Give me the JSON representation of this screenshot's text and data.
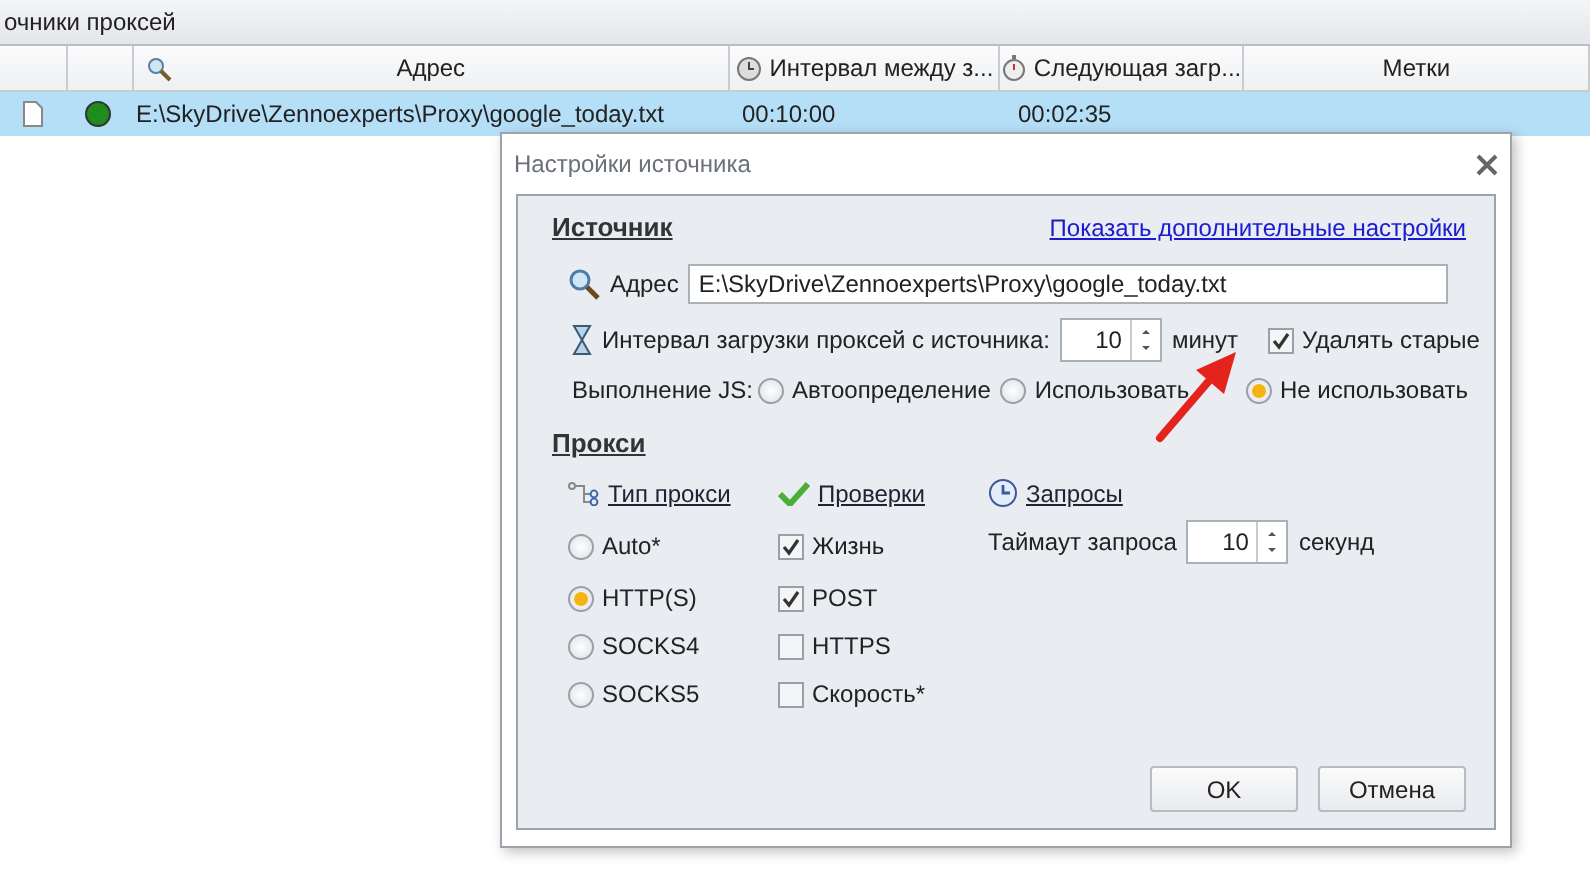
{
  "panel_title": "очники проксей",
  "table": {
    "columns": [
      "",
      "",
      "Адрес",
      "Интервал между з...",
      "Следующая загр...",
      "Метки"
    ],
    "rows": [
      {
        "selected": true,
        "active": true,
        "address": "E:\\SkyDrive\\Zennoexperts\\Proxy\\google_today.txt",
        "interval": "00:10:00",
        "next": "00:02:35"
      }
    ]
  },
  "dialog": {
    "title": "Настройки источника",
    "source": {
      "heading": "Источник",
      "more_link": "Показать дополнительные настройки",
      "address_label": "Адрес",
      "address_value": "E:\\SkyDrive\\Zennoexperts\\Proxy\\google_today.txt",
      "interval_label": "Интервал загрузки проксей с источника:",
      "interval_value": "10",
      "interval_unit": "минут",
      "delete_old": {
        "label": "Удалять старые",
        "checked": true
      },
      "js_label": "Выполнение JS:",
      "js_options": [
        {
          "label": "Автоопределение",
          "selected": false
        },
        {
          "label": "Использовать",
          "selected": false
        },
        {
          "label": "Не использовать",
          "selected": true
        }
      ]
    },
    "proxy": {
      "heading": "Прокси",
      "type_link": "Тип прокси",
      "checks_link": "Проверки",
      "requests_link": "Запросы",
      "types": [
        {
          "label": "Auto*",
          "selected": false
        },
        {
          "label": "HTTP(S)",
          "selected": true
        },
        {
          "label": "SOCKS4",
          "selected": false
        },
        {
          "label": "SOCKS5",
          "selected": false
        }
      ],
      "checks": [
        {
          "label": "Жизнь",
          "checked": true
        },
        {
          "label": "POST",
          "checked": true
        },
        {
          "label": "HTTPS",
          "checked": false
        },
        {
          "label": "Скорость*",
          "checked": false
        }
      ],
      "timeout_label": "Таймаут запроса",
      "timeout_value": "10",
      "timeout_unit": "секунд"
    },
    "buttons": [
      "OK",
      "Отмена"
    ]
  }
}
